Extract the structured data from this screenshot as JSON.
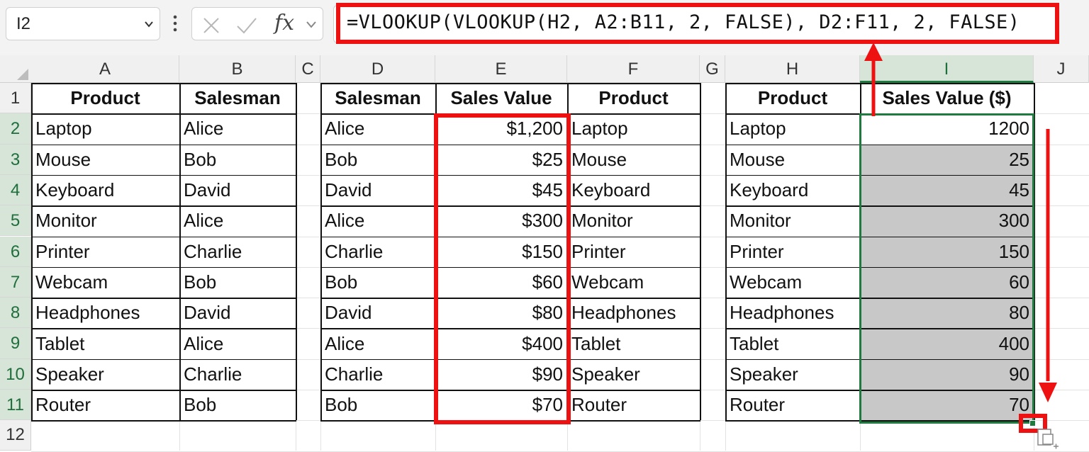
{
  "namebox": {
    "value": "I2",
    "icon": "chevron-down-icon"
  },
  "formula_bar": {
    "cancel_icon": "x-icon",
    "enter_icon": "check-icon",
    "fx_label": "fx",
    "formula": "=VLOOKUP(VLOOKUP(H2, A2:B11, 2, FALSE), D2:F11, 2, FALSE)"
  },
  "columns": [
    "A",
    "B",
    "C",
    "D",
    "E",
    "F",
    "G",
    "H",
    "I",
    "J"
  ],
  "rows": [
    "1",
    "2",
    "3",
    "4",
    "5",
    "6",
    "7",
    "8",
    "9",
    "10",
    "11",
    "12"
  ],
  "headers": {
    "A": "Product",
    "B": "Salesman",
    "D": "Salesman",
    "E": "Sales Value",
    "F": "Product",
    "H": "Product",
    "I": "Sales Value ($)"
  },
  "table1": [
    [
      "Laptop",
      "Alice"
    ],
    [
      "Mouse",
      "Bob"
    ],
    [
      "Keyboard",
      "David"
    ],
    [
      "Monitor",
      "Alice"
    ],
    [
      "Printer",
      "Charlie"
    ],
    [
      "Webcam",
      "Bob"
    ],
    [
      "Headphones",
      "David"
    ],
    [
      "Tablet",
      "Alice"
    ],
    [
      "Speaker",
      "Charlie"
    ],
    [
      "Router",
      "Bob"
    ]
  ],
  "table2": [
    [
      "Alice",
      "$1,200",
      "Laptop"
    ],
    [
      "Bob",
      "$25",
      "Mouse"
    ],
    [
      "David",
      "$45",
      "Keyboard"
    ],
    [
      "Alice",
      "$300",
      "Monitor"
    ],
    [
      "Charlie",
      "$150",
      "Printer"
    ],
    [
      "Bob",
      "$60",
      "Webcam"
    ],
    [
      "David",
      "$80",
      "Headphones"
    ],
    [
      "Alice",
      "$400",
      "Tablet"
    ],
    [
      "Charlie",
      "$90",
      "Speaker"
    ],
    [
      "Bob",
      "$70",
      "Router"
    ]
  ],
  "table3": [
    [
      "Laptop",
      "1200"
    ],
    [
      "Mouse",
      "25"
    ],
    [
      "Keyboard",
      "45"
    ],
    [
      "Monitor",
      "300"
    ],
    [
      "Printer",
      "150"
    ],
    [
      "Webcam",
      "60"
    ],
    [
      "Headphones",
      "80"
    ],
    [
      "Tablet",
      "400"
    ],
    [
      "Speaker",
      "90"
    ],
    [
      "Router",
      "70"
    ]
  ],
  "colors": {
    "annotation": "#e11111",
    "selection": "#1e7a3f",
    "shade": "#c8c8c8"
  }
}
